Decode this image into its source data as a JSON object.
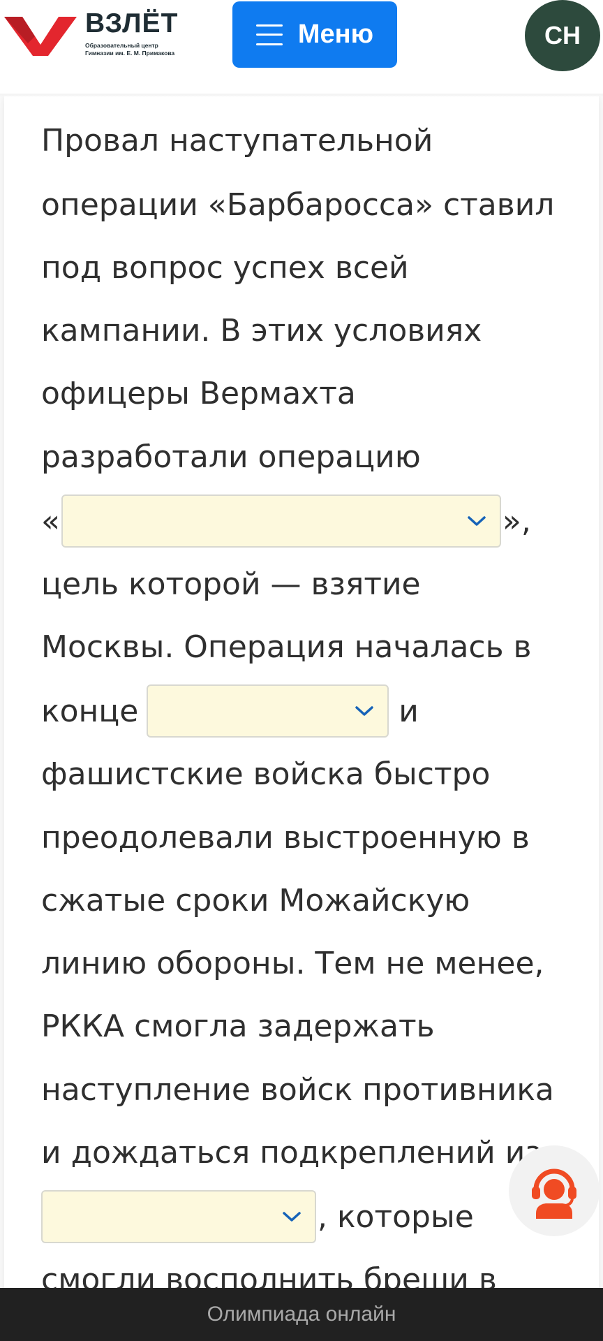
{
  "header": {
    "logo_title": "ВЗЛЁТ",
    "logo_subtitle_1": "Образовательный центр",
    "logo_subtitle_2": "Гимназии им. Е. М. Примакова",
    "menu_label": "Меню",
    "avatar_initials": "CH"
  },
  "content": {
    "lines": [
      "Провал наступательной",
      "операции «Барбаросса» ставил",
      "под вопрос успех всей",
      "кампании. В этих условиях",
      "офицеры Вермахта",
      "разработали операцию"
    ],
    "line7_prefix": "«",
    "line7_suffix": "»,",
    "line8": "цель которой — взятие",
    "line9": "Москвы. Операция началась в",
    "line10_prefix": "конце",
    "line10_suffix": "и",
    "lines_b": [
      "фашистские войска быстро",
      "преодолевали выстроенную в",
      "сжатые сроки Можайскую",
      "линию обороны. Тем не менее,",
      "РККА смогла задержать",
      "наступление войск противника",
      "и дождаться подкреплений из"
    ],
    "line18_suffix": ", которые",
    "line19": "смогли восполнить бреши в",
    "dropdowns": [
      {
        "selected": ""
      },
      {
        "selected": ""
      },
      {
        "selected": ""
      }
    ]
  },
  "footer": {
    "label": "Олимпиада онлайн"
  },
  "icons": {
    "dropdown": "chevron-down-icon",
    "menu": "hamburger-icon",
    "support": "support-agent-icon"
  },
  "colors": {
    "brand_red": "#e3262e",
    "menu_blue": "#0f7bf0",
    "avatar_green": "#2d4a3d",
    "select_bg": "#fdf9dd",
    "support_orange": "#f04b23",
    "chevron_blue": "#1663b8"
  }
}
